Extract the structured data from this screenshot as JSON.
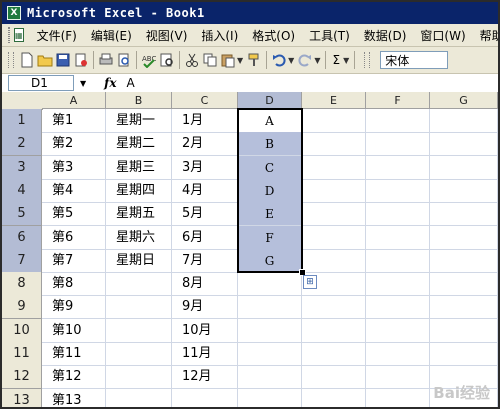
{
  "window": {
    "title": "Microsoft Excel - Book1",
    "app_icon_letter": "X"
  },
  "menu": {
    "doc_icon": "excel-doc-icon",
    "items": [
      "文件(F)",
      "编辑(E)",
      "视图(V)",
      "插入(I)",
      "格式(O)",
      "工具(T)",
      "数据(D)",
      "窗口(W)",
      "帮助(H)"
    ]
  },
  "toolbar": {
    "sum_symbol": "Σ",
    "font_name": "宋体",
    "icons": [
      "new-icon",
      "open-icon",
      "save-icon",
      "permission-icon",
      "print-icon",
      "print-preview-icon",
      "spelling-icon",
      "research-icon",
      "cut-icon",
      "copy-icon",
      "paste-icon",
      "format-painter-icon",
      "undo-icon",
      "redo-icon",
      "autosum-icon"
    ]
  },
  "formula_bar": {
    "name_box": "D1",
    "fx": "fx",
    "content": "A"
  },
  "sheet": {
    "columns": [
      "A",
      "B",
      "C",
      "D",
      "E",
      "F",
      "G"
    ],
    "rows": [
      "1",
      "2",
      "3",
      "4",
      "5",
      "6",
      "7",
      "8",
      "9",
      "10",
      "11",
      "12",
      "13"
    ],
    "selected_column": "D",
    "selection_range": "D1:D7",
    "cells": [
      [
        "第1",
        "星期一",
        "1月",
        "A",
        "",
        "",
        ""
      ],
      [
        "第2",
        "星期二",
        "2月",
        "B",
        "",
        "",
        ""
      ],
      [
        "第3",
        "星期三",
        "3月",
        "C",
        "",
        "",
        ""
      ],
      [
        "第4",
        "星期四",
        "4月",
        "D",
        "",
        "",
        ""
      ],
      [
        "第5",
        "星期五",
        "5月",
        "E",
        "",
        "",
        ""
      ],
      [
        "第6",
        "星期六",
        "6月",
        "F",
        "",
        "",
        ""
      ],
      [
        "第7",
        "星期日",
        "7月",
        "G",
        "",
        "",
        ""
      ],
      [
        "第8",
        "",
        "8月",
        "",
        "",
        "",
        ""
      ],
      [
        "第9",
        "",
        "9月",
        "",
        "",
        "",
        ""
      ],
      [
        "第10",
        "",
        "10月",
        "",
        "",
        "",
        ""
      ],
      [
        "第11",
        "",
        "11月",
        "",
        "",
        "",
        ""
      ],
      [
        "第12",
        "",
        "12月",
        "",
        "",
        "",
        ""
      ],
      [
        "第13",
        "",
        "",
        "",
        "",
        "",
        ""
      ]
    ]
  },
  "autofill_options_icon": "autofill-options-icon",
  "watermark": "Bai经验"
}
